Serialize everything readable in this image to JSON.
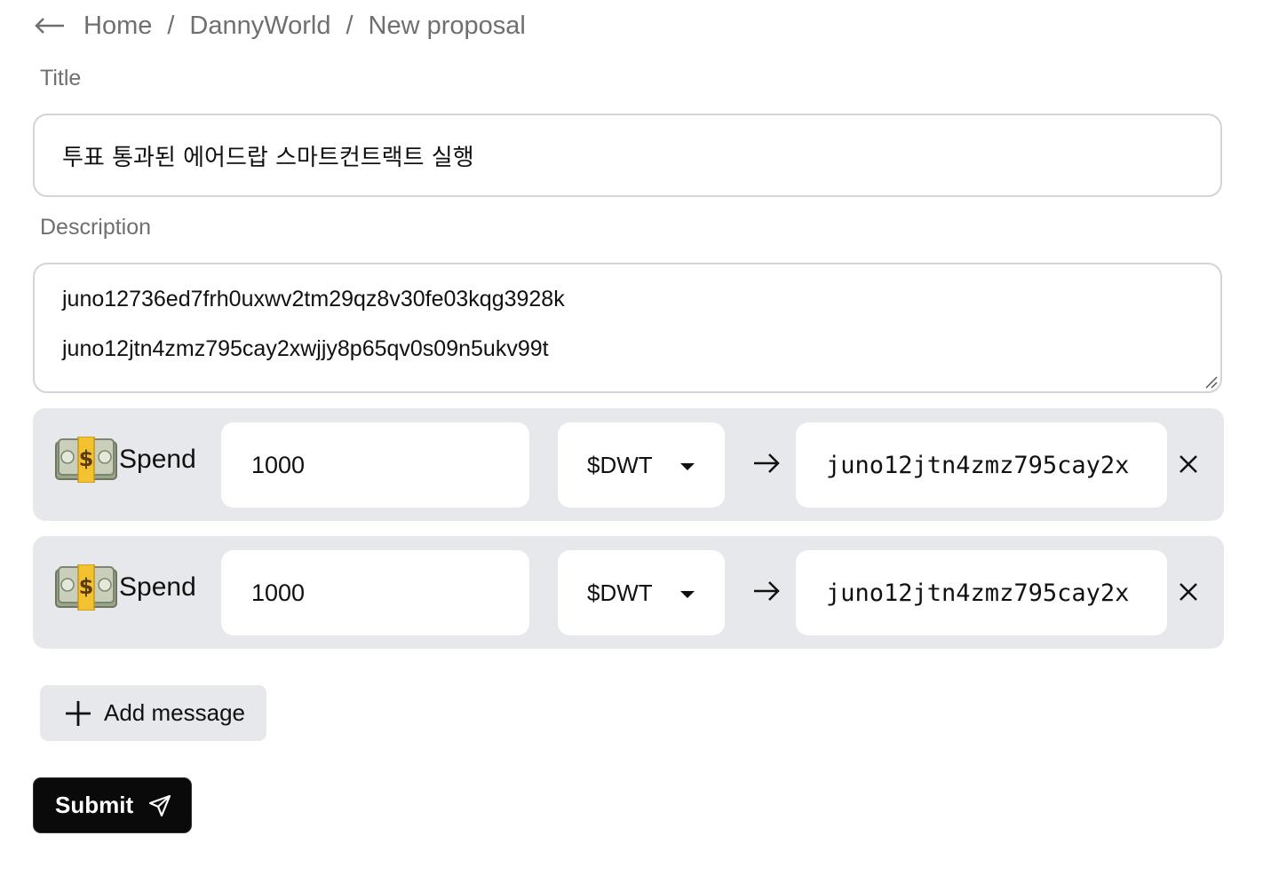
{
  "breadcrumb": {
    "items": [
      "Home",
      "DannyWorld",
      "New proposal"
    ],
    "separator": "/"
  },
  "form": {
    "title_label": "Title",
    "title_value": "투표 통과된 에어드랍 스마트컨트랙트 실행",
    "description_label": "Description",
    "description_lines": [
      "juno12736ed7frh0uxwv2tm29qz8v30fe03kqg3928k",
      "juno12jtn4zmz795cay2xwjjy8p65qv0s09n5ukv99t"
    ]
  },
  "messages": [
    {
      "type_label": "Spend",
      "amount": "1000",
      "token": "$DWT",
      "address": "juno12jtn4zmz795cay2x"
    },
    {
      "type_label": "Spend",
      "amount": "1000",
      "token": "$DWT",
      "address": "juno12jtn4zmz795cay2x"
    }
  ],
  "actions": {
    "add_message_label": "Add message",
    "submit_label": "Submit"
  },
  "icons": {
    "back": "arrow-left-icon",
    "money": "dollar-banknote-icon",
    "dropdown": "caret-down-icon",
    "to": "arrow-right-icon",
    "remove": "close-icon",
    "add": "plus-icon",
    "submit": "send-icon"
  },
  "colors": {
    "row_background": "#e7e8eb",
    "submit_background": "#0a0a0a",
    "muted_text": "#6f6f6f"
  }
}
